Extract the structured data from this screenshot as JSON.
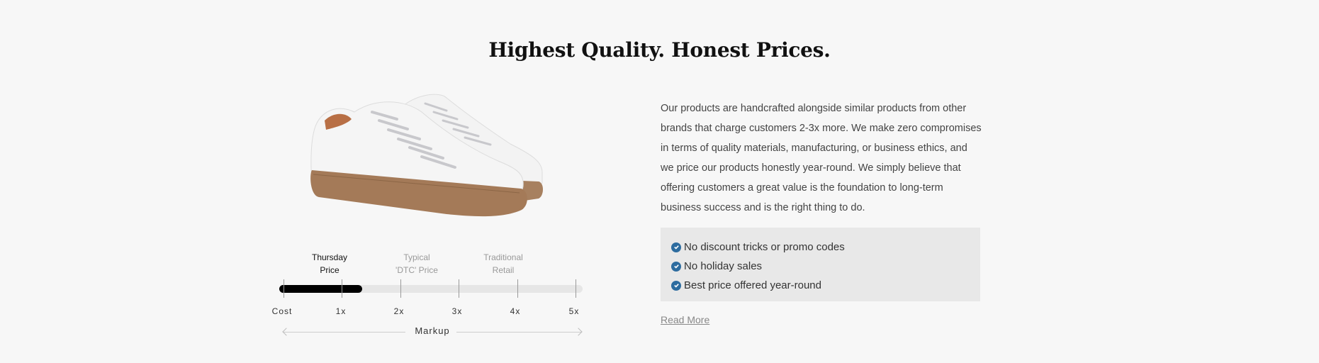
{
  "header": {
    "title": "Highest Quality. Honest Prices."
  },
  "product_image": {
    "alt": "white leather sneaker with gum sole"
  },
  "markup_chart": {
    "price_labels": [
      {
        "line1": "Thursday",
        "line2": "Price",
        "active": true,
        "markup": 1
      },
      {
        "line1": "Typical",
        "line2": "'DTC' Price",
        "active": false,
        "markup": 2.5
      },
      {
        "line1": "Traditional",
        "line2": "Retail",
        "active": false,
        "markup": 4
      }
    ],
    "tick_labels": [
      "Cost",
      "1x",
      "2x",
      "3x",
      "4x",
      "5x"
    ],
    "axis_title": "Markup",
    "fill_markup": 1.35
  },
  "copy": {
    "paragraph": "Our products are handcrafted alongside similar products from other brands that charge customers 2-3x more. We make zero compromises in terms of quality materials, manufacturing, or business ethics, and we price our products honestly year-round. We simply believe that offering customers a great value is the foundation to long-term business success and is the right thing to do."
  },
  "features": {
    "items": [
      "No discount tricks or promo codes",
      "No holiday sales",
      "Best price offered year-round"
    ]
  },
  "read_more": {
    "label": "Read More"
  },
  "colors": {
    "accent": "#2d6c9f",
    "fill": "#000000",
    "track": "#e6e6e6"
  }
}
